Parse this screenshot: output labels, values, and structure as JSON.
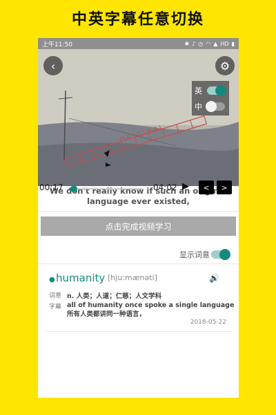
{
  "banner": {
    "title": "中英字幕任意切换"
  },
  "status_bar": {
    "time": "上午11:50",
    "network": "HD",
    "icons": [
      "bluetooth-icon",
      "mute-icon",
      "alarm-icon",
      "wifi-icon",
      "signal-icon",
      "battery-icon"
    ]
  },
  "video": {
    "scene_text": "ORIGINAL",
    "lang_panel": {
      "english_label": "英",
      "english_on": true,
      "chinese_label": "中",
      "chinese_on": false
    }
  },
  "subtitle": {
    "text": "We don't really know if such an original language ever existed,"
  },
  "player": {
    "current_time": "00:17",
    "duration": "04:02",
    "progress": 0.07
  },
  "actions": {
    "complete_label": "点击完成视频学习"
  },
  "vocab_toggle": {
    "label": "显示词意",
    "on": true
  },
  "word_card": {
    "word": "humanity",
    "phonetic": "[hju:mænəti]",
    "definition_tag": "词意",
    "definition": "n. 人类；人道；仁慈；人文学科",
    "subtitle_tag": "字幕",
    "subtitle_en": "all of humanity once spoke a single language",
    "subtitle_zh": "所有人类都讲同一种语言，",
    "date": "2018-05-22"
  },
  "colors": {
    "accent": "#138a7d",
    "background": "#FFE500",
    "button_gray": "#a9a9a9"
  }
}
